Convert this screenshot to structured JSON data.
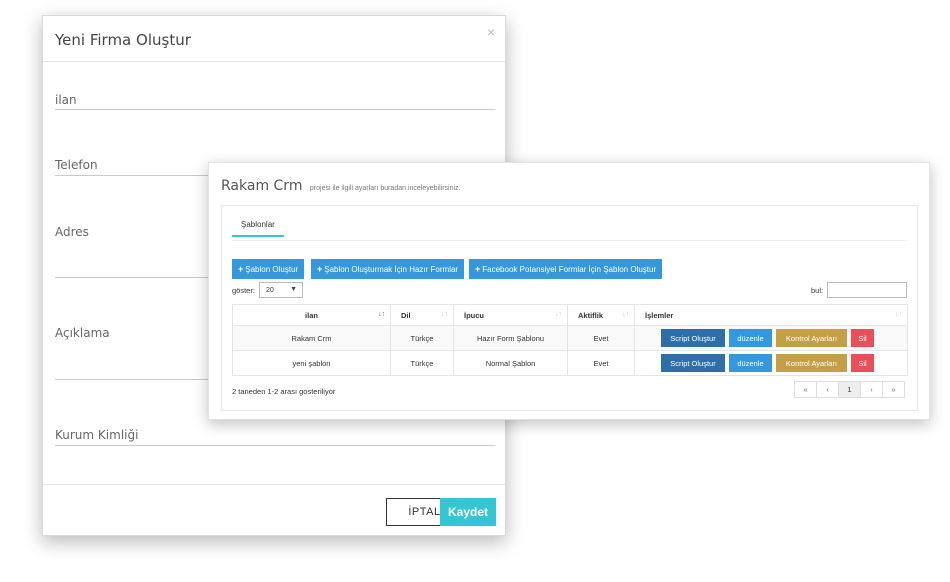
{
  "modal": {
    "title": "Yeni Firma Oluştur",
    "close": "×",
    "fields": [
      {
        "label": "ilan"
      },
      {
        "label": "Telefon"
      },
      {
        "label": "Adres"
      },
      {
        "label": "Açıklama"
      },
      {
        "label": "Kurum Kimliği"
      }
    ],
    "cancel_label": "İPTAL",
    "save_label": "Kaydet"
  },
  "panel": {
    "title": "Rakam Crm",
    "subtitle": "projesi ile ilgili ayarları buradan inceleyebilirsiniz.",
    "tab": "Şablonlar",
    "buttons": [
      {
        "plus": "+",
        "label": "Şablon Oluştur"
      },
      {
        "plus": "+",
        "label": "Şablon Oluşturmak İçin Hazır Formlar"
      },
      {
        "plus": "+",
        "label": "Facebook Potansiyel Formlar İçin Şablon Oluştur"
      }
    ],
    "show_label": "göster:",
    "show_value": "20",
    "find_label": "bul:",
    "columns": [
      "ilan",
      "Dil",
      "İpucu",
      "Aktiflik",
      "İşlemler"
    ],
    "rows": [
      {
        "ilan": "Rakam Crm",
        "dil": "Türkçe",
        "ipucu": "Hazır Form Şablonu",
        "aktiflik": "Evet"
      },
      {
        "ilan": "yeni şablon",
        "dil": "Türkçe",
        "ipucu": "Normal Şablon",
        "aktiflik": "Evet"
      }
    ],
    "row_actions": {
      "script": "Script Oluştur",
      "edit": "düzenle",
      "control": "Kontrol Ayarları",
      "delete": "Sil"
    },
    "summary": "2 taneden 1-2 arası gosteriliyor",
    "pagination": [
      "«",
      "‹",
      "1",
      "›",
      "»"
    ],
    "current_page": "1"
  }
}
